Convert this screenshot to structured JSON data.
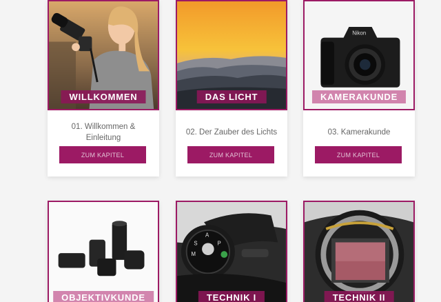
{
  "colors": {
    "accent": "#9c1a64",
    "banner_light": "#cd78a5",
    "page_bg": "#f4f4f4"
  },
  "cards_row1": [
    {
      "banner": "WILLKOMMEN",
      "title": "01. Willkommen & Einleitung",
      "button": "ZUM KAPITEL"
    },
    {
      "banner": "DAS LICHT",
      "title": "02. Der Zauber des Lichts",
      "button": "ZUM KAPITEL"
    },
    {
      "banner": "KAMERAKUNDE",
      "title": "03. Kamerakunde",
      "button": "ZUM KAPITEL"
    }
  ],
  "cards_row2": [
    {
      "banner": "OBJEKTIVKUNDE"
    },
    {
      "banner": "TECHNIK I"
    },
    {
      "banner": "TECHNIK II"
    }
  ],
  "images": {
    "camera_brand": "Nikon",
    "mode_dial_letters": [
      "A",
      "S",
      "M",
      "P"
    ]
  }
}
